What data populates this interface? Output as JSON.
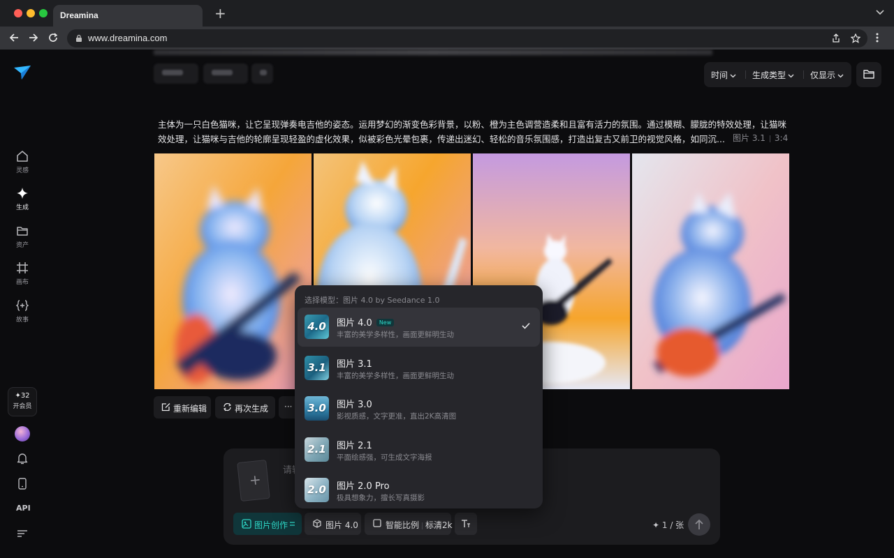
{
  "browser": {
    "tab_title": "Dreamina",
    "url": "www.dreamina.com"
  },
  "sidebar": {
    "items": [
      {
        "label": "灵感",
        "icon": "home-icon"
      },
      {
        "label": "生成",
        "icon": "sparkle-icon",
        "active": true
      },
      {
        "label": "资产",
        "icon": "folder-icon"
      },
      {
        "label": "画布",
        "icon": "canvas-icon"
      },
      {
        "label": "故事",
        "icon": "story-icon"
      }
    ],
    "vip_count": "✦32",
    "vip_label": "开会员",
    "api_label": "API"
  },
  "filters": {
    "time": "时间",
    "type": "生成类型",
    "show_only": "仅显示"
  },
  "prompt": {
    "line1": "主体为一只白色猫咪，让它呈现弹奏电吉他的姿态。运用梦幻的渐变色彩背景，以粉、橙为主色调营造柔和且富有活力的氛围。通过模糊、朦胧的特效处理，让猫咪",
    "line2": "效处理，让猫咪与吉他的轮廓呈现轻盈的虚化效果，似被彩色光晕包裹，传递出迷幻、轻松的音乐氛围感，打造出复古又前卫的视觉风格，如同沉...",
    "model": "图片 3.1",
    "ratio": "3:4"
  },
  "actions": {
    "reedit": "重新编辑",
    "regenerate": "再次生成",
    "more": "···"
  },
  "composer": {
    "placeholder": "请输",
    "mode": "图片创作",
    "model": "图片 4.0",
    "ratio": "智能比例",
    "quality": "标清2k",
    "credits": "1 / 张"
  },
  "dropdown": {
    "header": "选择模型：图片 4.0 by Seedance 1.0",
    "models": [
      {
        "name": "图片 4.0",
        "badge": "New",
        "desc": "丰富的美学多样性，画面更鲜明生动",
        "thumb": "4.0",
        "selected": true
      },
      {
        "name": "图片 3.1",
        "desc": "丰富的美学多样性，画面更鲜明生动",
        "thumb": "3.1"
      },
      {
        "name": "图片 3.0",
        "desc": "影视质感，文字更准，直出2K高清图",
        "thumb": "3.0"
      },
      {
        "name": "图片 2.1",
        "desc": "平面绘感强，可生成文字海报",
        "thumb": "2.1"
      },
      {
        "name": "图片 2.0 Pro",
        "desc": "极具想象力，擅长写真摄影",
        "thumb": "2.0"
      }
    ]
  },
  "colors": {
    "accent": "#2ed8c8",
    "panel": "#1c1c1f",
    "dropdown": "#26262b"
  }
}
